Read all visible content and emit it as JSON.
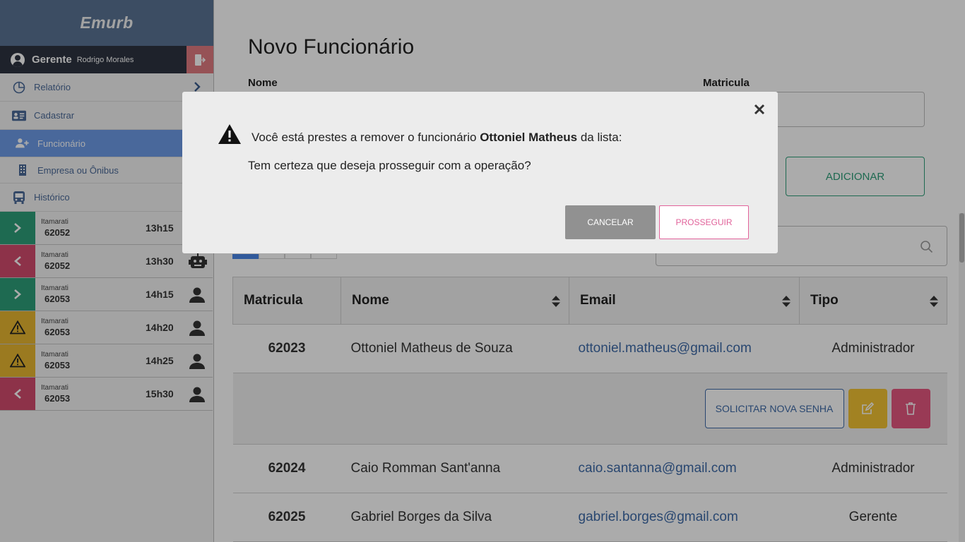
{
  "sidebar": {
    "brand": "Emurb",
    "user": {
      "role": "Gerente",
      "name": "Rodrigo Morales"
    },
    "menu": [
      {
        "label": "Relatório"
      },
      {
        "label": "Cadastrar"
      },
      {
        "label": "Funcionário"
      },
      {
        "label": "Empresa ou Ônibus"
      },
      {
        "label": "Histórico"
      }
    ],
    "trips": [
      {
        "line": "Itamarati",
        "bus": "62052",
        "time": "13h15",
        "status": "in",
        "color": "#2e9e79"
      },
      {
        "line": "Itamarati",
        "bus": "62052",
        "time": "13h30",
        "status": "out",
        "color": "#d34b6d"
      },
      {
        "line": "Itamarati",
        "bus": "62053",
        "time": "14h15",
        "status": "in",
        "color": "#2e9e79"
      },
      {
        "line": "Itamarati",
        "bus": "62053",
        "time": "14h20",
        "status": "warning",
        "color": "#e8b730"
      },
      {
        "line": "Itamarati",
        "bus": "62053",
        "time": "14h25",
        "status": "warning",
        "color": "#e8b730"
      },
      {
        "line": "Itamarati",
        "bus": "62053",
        "time": "15h30",
        "status": "out",
        "color": "#d34b6d"
      }
    ]
  },
  "main": {
    "title": "Novo Funcionário",
    "form": {
      "name_label": "Nome",
      "matricula_label": "Matricula",
      "add_button": "ADICIONAR"
    },
    "table": {
      "headers": [
        "Matricula",
        "Nome",
        "Email",
        "Tipo"
      ],
      "rows": [
        {
          "matricula": "62023",
          "nome": "Ottoniel Matheus de Souza",
          "email": "ottoniel.matheus@gmail.com",
          "tipo": "Administrador"
        },
        {
          "matricula": "62024",
          "nome": "Caio Romman Sant'anna",
          "email": "caio.santanna@gmail.com",
          "tipo": "Administrador"
        },
        {
          "matricula": "62025",
          "nome": "Gabriel Borges da Silva",
          "email": "gabriel.borges@gmail.com",
          "tipo": "Gerente"
        }
      ],
      "reset_password_button": "SOLICITAR NOVA SENHA"
    }
  },
  "modal": {
    "message_prefix": "Você está prestes a remover o funcionário",
    "employee": "Ottoniel Matheus",
    "message_suffix": "da lista:",
    "question": "Tem certeza que deseja prosseguir com a operação?",
    "cancel": "CANCELAR",
    "confirm": "PROSSEGUIR"
  }
}
